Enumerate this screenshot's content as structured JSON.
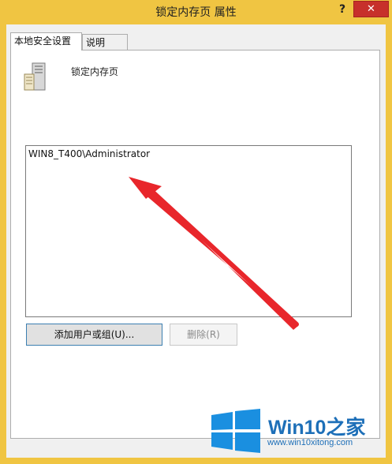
{
  "window": {
    "title": "锁定内存页 属性",
    "help_label": "?",
    "close_label": "✕"
  },
  "tabs": [
    {
      "label": "本地安全设置",
      "active": true
    },
    {
      "label": "说明",
      "active": false
    }
  ],
  "policy": {
    "name": "锁定内存页",
    "icon": "server-icon"
  },
  "principals": [
    "WIN8_T400\\Administrator"
  ],
  "buttons": {
    "add": "添加用户或组(U)...",
    "remove": "删除(R)"
  },
  "watermark": {
    "brand": "Win10",
    "brand_suffix": "之家",
    "url": "www.win10xitong.com"
  },
  "colors": {
    "frame": "#f0c542",
    "close": "#c7302b",
    "arrow": "#e8262b",
    "watermark": "#1d6fb8"
  }
}
